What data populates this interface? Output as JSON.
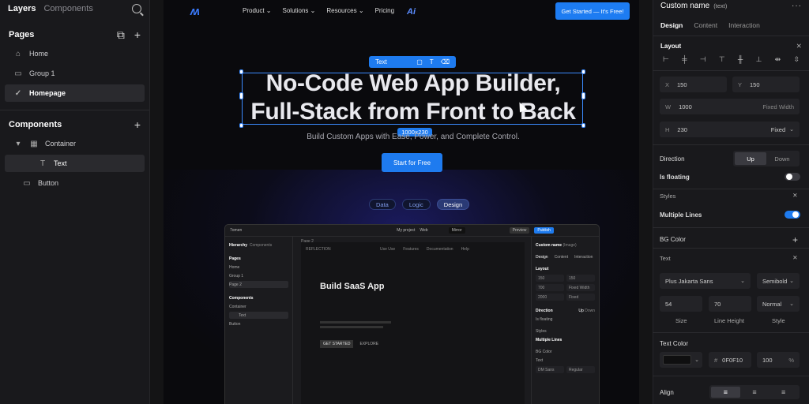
{
  "left": {
    "tabs": [
      "Layers",
      "Components"
    ],
    "pages_title": "Pages",
    "pages": [
      "Home",
      "Group 1",
      "Homepage"
    ],
    "components_title": "Components",
    "components": [
      "Container",
      "Text",
      "Button"
    ]
  },
  "site": {
    "nav": {
      "links": [
        "Product",
        "Solutions",
        "Resources",
        "Pricing"
      ],
      "ai": "Ai",
      "cta": "Get Started — It's Free!"
    },
    "headline": [
      "No-Code Web App Builder,",
      "Full-Stack from Front to Back"
    ],
    "toolbar_label": "Text",
    "size_badge": "1000×230",
    "subtitle": "Build Custom Apps with Ease, Power, and Complete Control.",
    "cta": "Start for Free",
    "pills": [
      "Data",
      "Logic",
      "Design"
    ],
    "mock": {
      "brand": "7omen",
      "project": "My project",
      "web": "Web",
      "mirror": "Mirror",
      "preview": "Preview",
      "publish": "Publish",
      "tabs": [
        "Hierarchy",
        "Components"
      ],
      "pages_title": "Pages",
      "pages": [
        "Home",
        "Group 1",
        "Page 2"
      ],
      "components_title": "Components",
      "components": [
        "Container",
        "Text",
        "Button"
      ],
      "page_label": "Page 2",
      "brand_center": "REFLECTION",
      "center_nav": [
        "Use Use",
        "Features",
        "Documentation",
        "Help"
      ],
      "center_title": "Build SaaS App",
      "center_btns": [
        "GET STARTED",
        "EXPLORE"
      ],
      "right_title": "Custom name",
      "right_sub": "(Image)",
      "right_tabs": [
        "Design",
        "Content",
        "Interaction"
      ],
      "layout_label": "Layout",
      "fields": [
        "150",
        "150",
        "700",
        "Fixed Width",
        "2000",
        "Fixed"
      ],
      "direction_label": "Direction",
      "direction_opts": [
        "Up",
        "Down"
      ],
      "floating_label": "Is floating",
      "styles_label": "Styles",
      "multiple_lines": "Multiple Lines",
      "bg_label": "BG Color",
      "text_label": "Text",
      "font": "DM Sans",
      "weight": "Regular"
    }
  },
  "right": {
    "title": "Custom name",
    "subtitle": "(text)",
    "tabs": [
      "Design",
      "Content",
      "Interaction"
    ],
    "layout": "Layout",
    "x_label": "X",
    "x": "150",
    "y_label": "Y",
    "y": "150",
    "w_label": "W",
    "w": "1000",
    "w_mode": "Fixed Width",
    "h_label": "H",
    "h": "230",
    "h_mode": "Fixed",
    "direction": "Direction",
    "direction_opts": [
      "Up",
      "Down"
    ],
    "floating": "Is floating",
    "styles": "Styles",
    "multiple_lines": "Multiple Lines",
    "bg_color": "BG Color",
    "text": "Text",
    "font": "Plus Jakarta Sans",
    "weight": "Semibold",
    "size": "54",
    "line_height": "70",
    "style": "Normal",
    "size_label": "Size",
    "line_height_label": "Line Height",
    "style_label": "Style",
    "text_color": "Text Color",
    "hex_prefix": "#",
    "hex": "0F0F10",
    "opacity": "100",
    "pct": "%",
    "align": "Align"
  },
  "colors": {
    "accent": "#1e7bef",
    "panel": "#19191c",
    "canvas": "#0a0a0d"
  }
}
